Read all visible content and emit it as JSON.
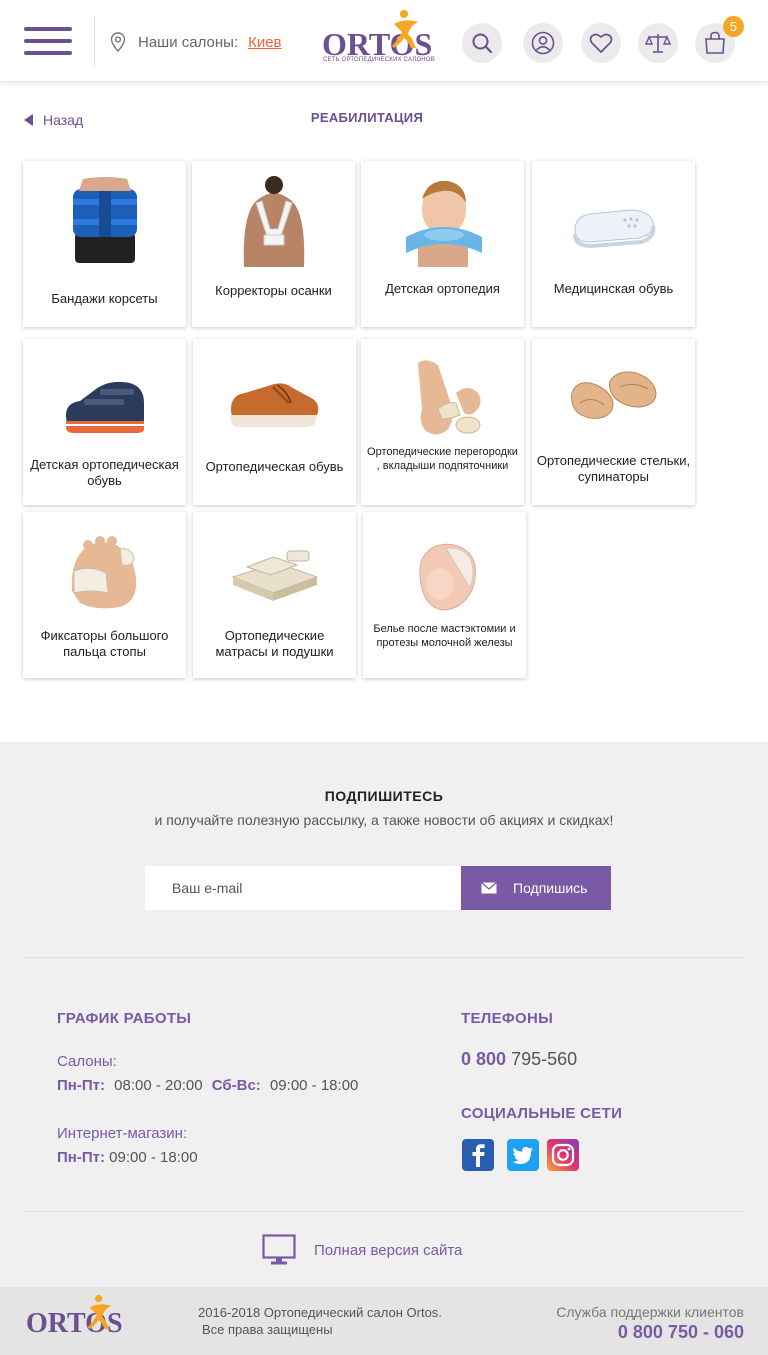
{
  "header": {
    "salons_label": "Наши салоны:",
    "city": "Киев",
    "logo_text": "ORTOS",
    "logo_sub": "СЕТЬ ОРТОПЕДИЧЕСКИХ САЛОНОВ",
    "cart_count": "5"
  },
  "nav": {
    "back_label": "Назад",
    "page_title": "РЕАБИЛИТАЦИЯ"
  },
  "categories": [
    {
      "label": "Бандажи корсеты",
      "icon": "belt-image"
    },
    {
      "label": "Корректоры осанки",
      "icon": "posture-corrector-image"
    },
    {
      "label": "Детская ортопедия",
      "icon": "child-neck-collar-image"
    },
    {
      "label": "Медицинская обувь",
      "icon": "medical-clog-image"
    },
    {
      "label": "Детская ортопедическая обувь",
      "icon": "child-sandal-image"
    },
    {
      "label": "Ортопедическая обувь",
      "icon": "orthopedic-shoe-image"
    },
    {
      "label": "Ортопедические перегородки , вкладыши подпяточники",
      "icon": "toe-separator-image"
    },
    {
      "label": "Ортопедические стельки, супинаторы",
      "icon": "insoles-image"
    },
    {
      "label": "Фиксаторы большого пальца стопы",
      "icon": "toe-fixator-image"
    },
    {
      "label": "Ортопедические матрасы и подушки",
      "icon": "mattress-image"
    },
    {
      "label": "Белье после мастэктомии и протезы молочной железы",
      "icon": "breast-prosthesis-image"
    }
  ],
  "subscribe": {
    "title": "ПОДПИШИТЕСЬ",
    "text": "и получайте полезную рассылку, а также новости об акциях и скидках!",
    "placeholder": "Ваш e-mail",
    "button": "Подпишись"
  },
  "footer": {
    "schedule_title": "ГРАФИК РАБОТЫ",
    "salons_label": "Салоны:",
    "weekdays_label": "Пн-Пт:",
    "weekdays_hours": "08:00 - 20:00",
    "weekend_label": "Сб-Вс:",
    "weekend_hours": "09:00 - 18:00",
    "shop_label": "Интернет-магазин:",
    "shop_days": "Пн-Пт:",
    "shop_hours": "09:00 - 18:00",
    "phones_title": "ТЕЛЕФОНЫ",
    "phone_prefix": "0 800",
    "phone_number": "795-560",
    "social_title": "СОЦИАЛЬНЫЕ СЕТИ",
    "full_version": "Полная версия сайта"
  },
  "bottom": {
    "copyright_line1": "2016-2018  Ортопедический салон Ortos.",
    "copyright_line2": "Все права защищены",
    "support_label": "Служба поддержки клиентов",
    "support_phone": "0 800 750 - 060"
  },
  "colors": {
    "brand": "#6b4f91",
    "accent": "#7a5aa5",
    "city_link": "#e8663d",
    "badge": "#f5a623"
  }
}
